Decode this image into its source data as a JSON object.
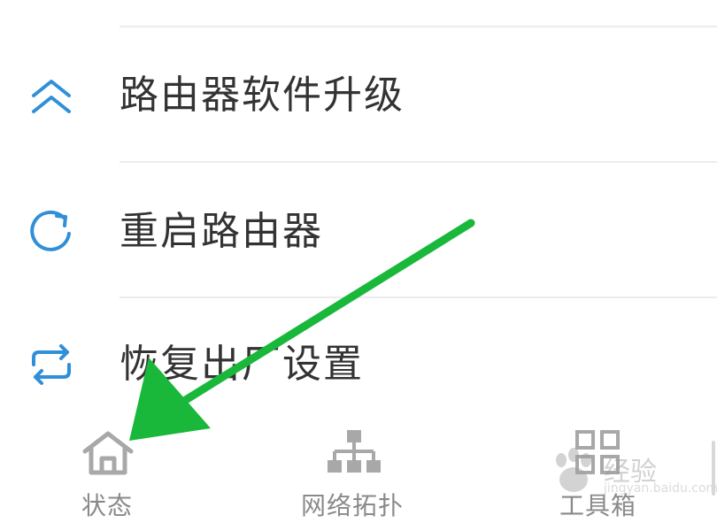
{
  "menu": {
    "items": [
      {
        "label": "路由器软件升级",
        "icon": "double-chevron-up-icon"
      },
      {
        "label": "重启路由器",
        "icon": "refresh-icon"
      },
      {
        "label": "恢复出厂设置",
        "icon": "swap-arrows-icon"
      }
    ]
  },
  "tabbar": {
    "tabs": [
      {
        "label": "状态",
        "icon": "home-icon"
      },
      {
        "label": "网络拓扑",
        "icon": "network-topology-icon"
      },
      {
        "label": "工具箱",
        "icon": "grid-icon"
      }
    ]
  },
  "watermark": {
    "text": "经验",
    "sub": "jingyan.baidu.com"
  },
  "colors": {
    "accent_blue": "#2f8fd8",
    "arrow_green": "#19b83a",
    "tab_gray": "#a8a8a8",
    "text_dark": "#333333"
  }
}
